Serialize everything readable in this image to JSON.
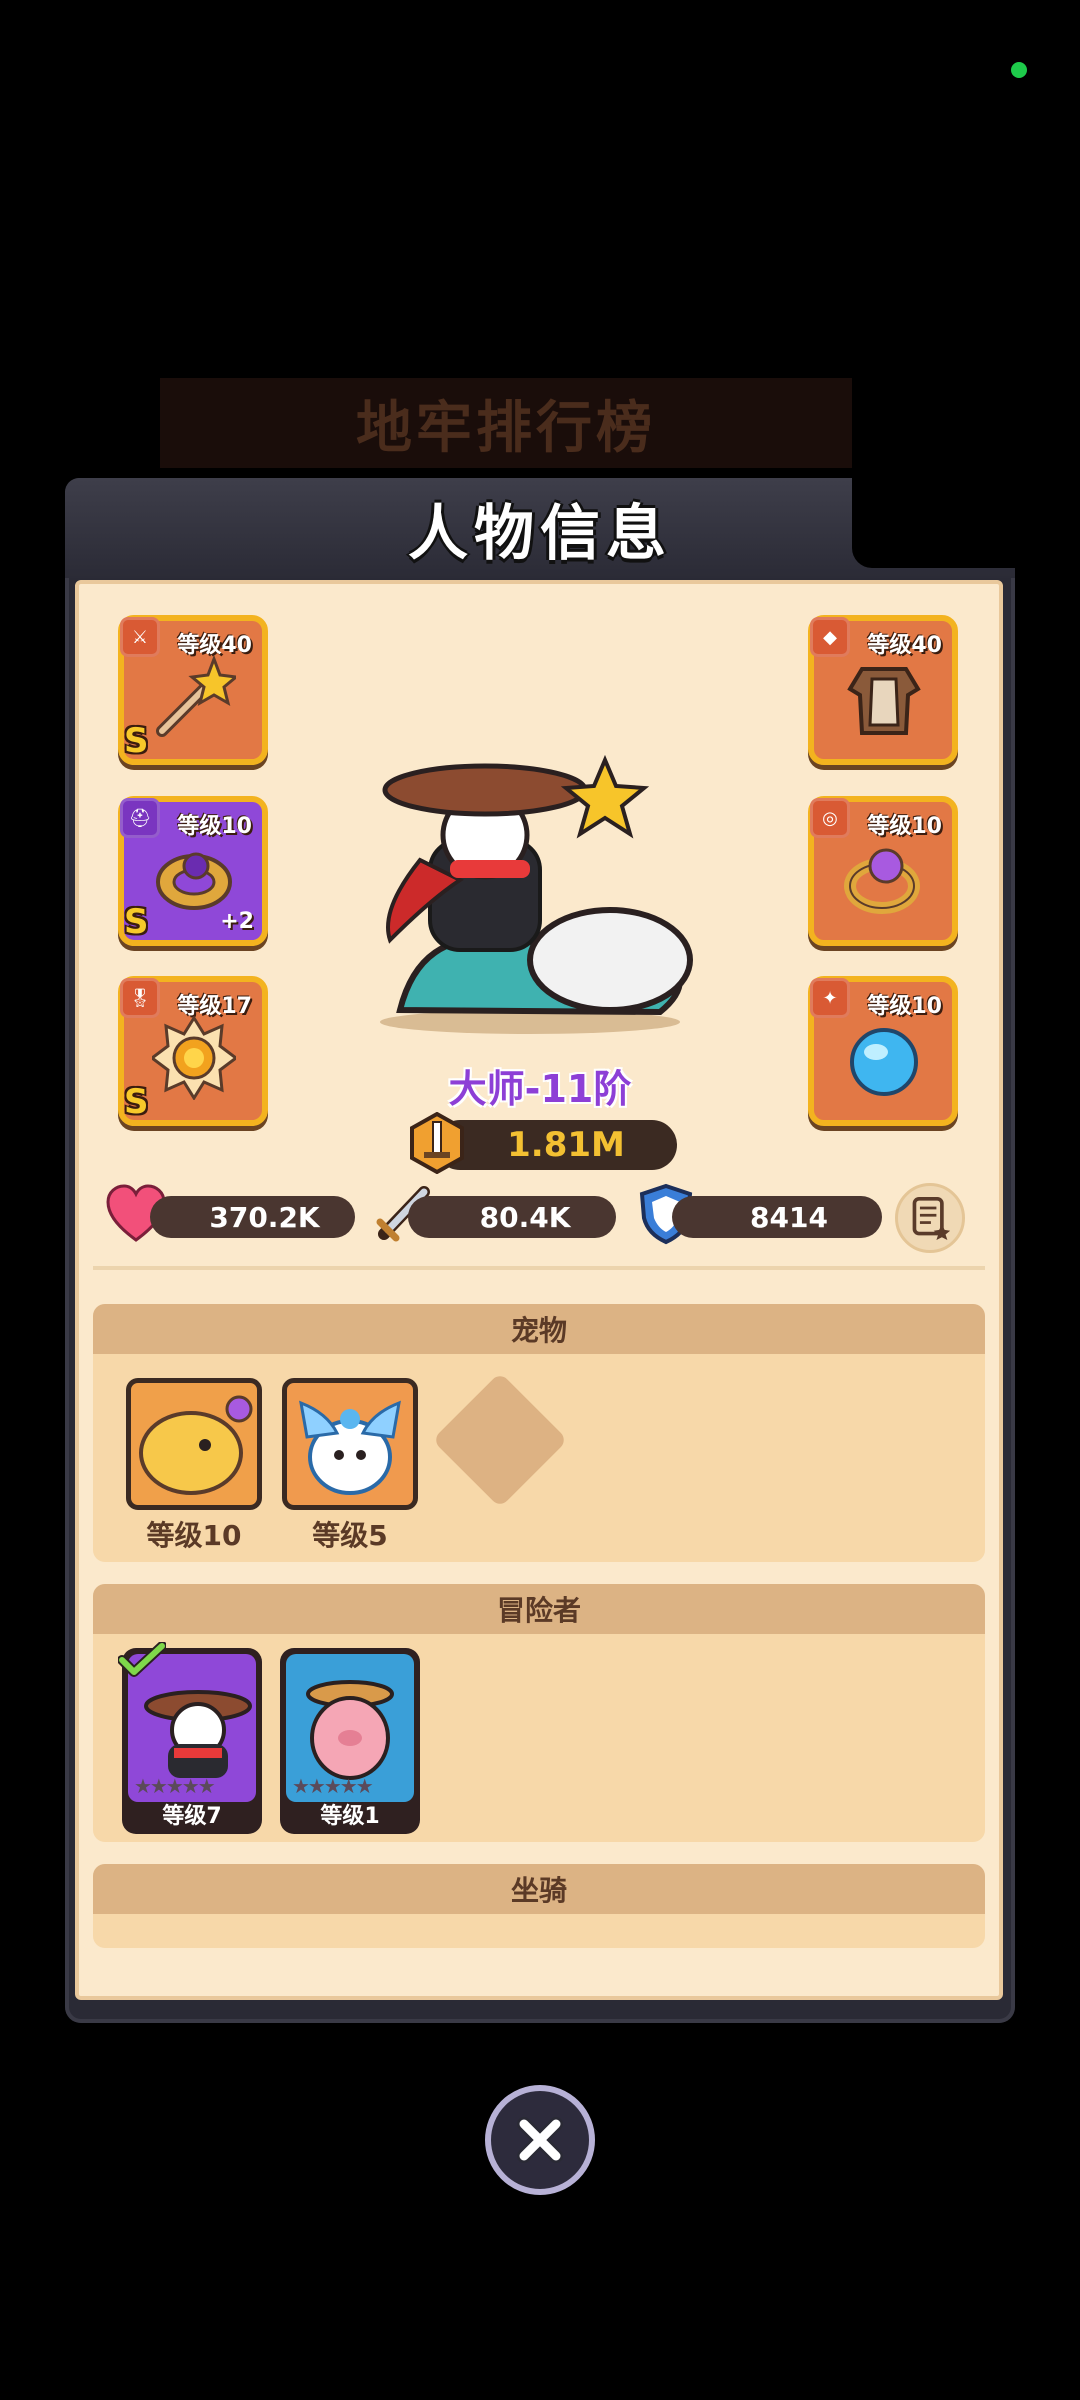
{
  "background_title": "地牢排行榜",
  "panel": {
    "title": "人物信息"
  },
  "equipment": {
    "left": [
      {
        "level": "等级40",
        "grade": "S",
        "icon": "wand-icon",
        "extra": ""
      },
      {
        "level": "等级10",
        "grade": "S",
        "icon": "gold-bracelet-icon",
        "extra": "+2"
      },
      {
        "level": "等级17",
        "grade": "S",
        "icon": "sun-emblem-icon",
        "extra": ""
      }
    ],
    "right": [
      {
        "level": "等级40",
        "icon": "armor-icon"
      },
      {
        "level": "等级10",
        "icon": "ring-icon"
      },
      {
        "level": "等级10",
        "icon": "blue-orb-icon"
      }
    ]
  },
  "hero": {
    "rank": "大师-11阶",
    "power": "1.81M"
  },
  "stats": {
    "hp": "370.2K",
    "attack": "80.4K",
    "defense": "8414"
  },
  "pets": {
    "title": "宠物",
    "items": [
      {
        "label": "等级10"
      },
      {
        "label": "等级5"
      }
    ]
  },
  "adventurers": {
    "title": "冒险者",
    "items": [
      {
        "label": "等级7",
        "stars": "★★★★★"
      },
      {
        "label": "等级1",
        "stars": "★★★★★"
      }
    ]
  },
  "mount": {
    "title": "坐骑"
  },
  "colors": {
    "accent_gold": "#f3b31f",
    "rank_purple": "#8d3fd6",
    "panel_cream": "#fbe9cc"
  }
}
